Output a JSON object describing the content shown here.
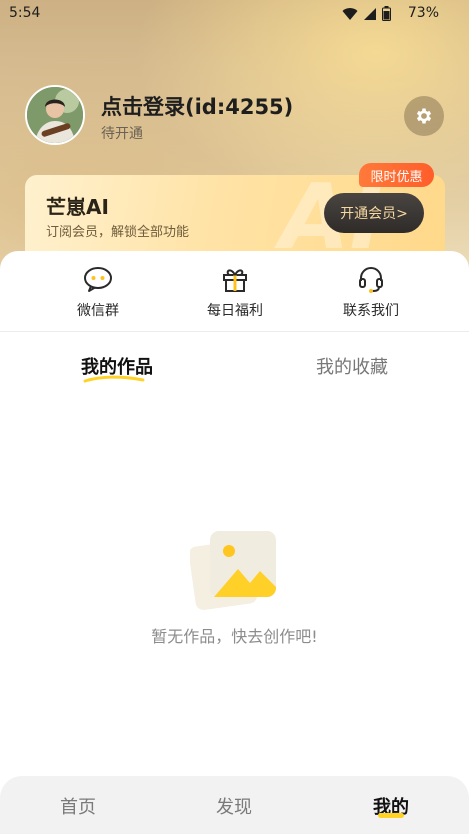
{
  "status_bar": {
    "time": "5:54",
    "battery": "73%"
  },
  "profile": {
    "name": "点击登录(id:4255)",
    "status": "待开通"
  },
  "vip_card": {
    "title": "芒崽AI",
    "subtitle": "订阅会员，解锁全部功能",
    "button": "开通会员>",
    "promo_tag": "限时优惠"
  },
  "quick_actions": [
    {
      "label": "微信群",
      "icon": "wechat-chat-icon"
    },
    {
      "label": "每日福利",
      "icon": "gift-icon"
    },
    {
      "label": "联系我们",
      "icon": "headset-icon"
    }
  ],
  "tabs": {
    "works": "我的作品",
    "favorites": "我的收藏"
  },
  "empty_state": {
    "text": "暂无作品，快去创作吧!"
  },
  "bottom_nav": {
    "home": "首页",
    "discover": "发现",
    "mine": "我的"
  },
  "colors": {
    "accent": "#ffd227",
    "promo": "#ff6a2e",
    "button_dark": "#3a3633"
  }
}
